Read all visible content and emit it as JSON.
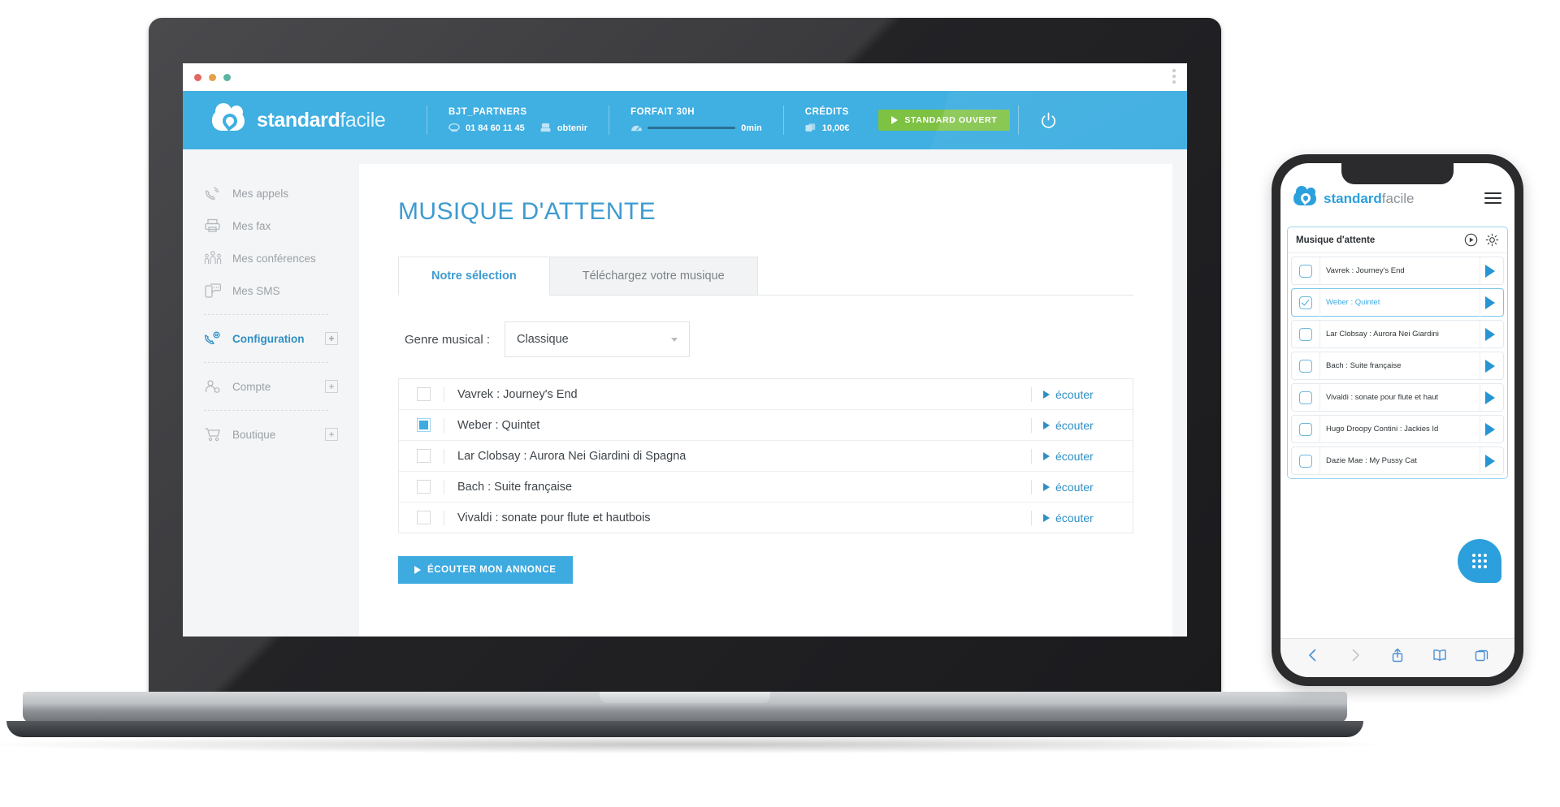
{
  "browser": {
    "kebab_icon": "kebab-menu-icon"
  },
  "header": {
    "brand_bold": "standard",
    "brand_light": "facile",
    "account": {
      "title": "BJT_PARTNERS",
      "phone": "01 84 60 11 45",
      "obtain_label": "obtenir"
    },
    "plan": {
      "title": "FORFAIT 30H",
      "usage": "0min"
    },
    "credits": {
      "title": "CRÉDITS",
      "amount": "10,00€"
    },
    "status_button": "STANDARD OUVERT",
    "accent": "#40afe1",
    "green": "#7dc242"
  },
  "sidebar": {
    "items": [
      {
        "label": "Mes appels",
        "icon": "phone-waves-icon",
        "active": false,
        "expandable": false
      },
      {
        "label": "Mes fax",
        "icon": "printer-icon",
        "active": false,
        "expandable": false
      },
      {
        "label": "Mes conférences",
        "icon": "people-group-icon",
        "active": false,
        "expandable": false
      },
      {
        "label": "Mes SMS",
        "icon": "sms-icon",
        "active": false,
        "expandable": false
      },
      {
        "label": "Configuration",
        "icon": "phone-gear-icon",
        "active": true,
        "expandable": true
      },
      {
        "label": "Compte",
        "icon": "user-gear-icon",
        "active": false,
        "expandable": true
      },
      {
        "label": "Boutique",
        "icon": "shopping-cart-icon",
        "active": false,
        "expandable": true
      }
    ],
    "expand_symbol": "+"
  },
  "main": {
    "page_title": "MUSIQUE D'ATTENTE",
    "tabs": [
      {
        "label": "Notre sélection",
        "active": true
      },
      {
        "label": "Téléchargez votre musique",
        "active": false
      }
    ],
    "filter_label": "Genre musical :",
    "genre_selected": "Classique",
    "tracks": [
      {
        "name": "Vavrek : Journey's End",
        "checked": false,
        "listen": "écouter"
      },
      {
        "name": "Weber : Quintet",
        "checked": true,
        "listen": "écouter"
      },
      {
        "name": "Lar Clobsay : Aurora Nei Giardini di Spagna",
        "checked": false,
        "listen": "écouter"
      },
      {
        "name": "Bach : Suite française",
        "checked": false,
        "listen": "écouter"
      },
      {
        "name": "Vivaldi : sonate pour flute et hautbois",
        "checked": false,
        "listen": "écouter"
      }
    ],
    "cta_label": "ÉCOUTER MON ANNONCE"
  },
  "phone": {
    "brand_bold": "standard",
    "brand_light": "facile",
    "menu_icon": "hamburger-menu-icon",
    "panel_title": "Musique d'attente",
    "panel_icons": [
      "play-circle-icon",
      "gear-icon"
    ],
    "tracks": [
      {
        "name": "Vavrek : Journey's End",
        "checked": false
      },
      {
        "name": "Weber : Quintet",
        "checked": true
      },
      {
        "name": "Lar Clobsay : Aurora Nei Giardini",
        "checked": false
      },
      {
        "name": "Bach : Suite française",
        "checked": false
      },
      {
        "name": "Vivaldi : sonate pour flute et haut",
        "checked": false
      },
      {
        "name": "Hugo Droopy Contini : Jackies Id",
        "checked": false
      },
      {
        "name": "Dazie Mae : My Pussy Cat",
        "checked": false
      }
    ],
    "dialpad_icon": "dialpad-icon",
    "bottom_bar": [
      "back-icon",
      "forward-icon",
      "share-icon",
      "bookmarks-icon",
      "tabs-icon"
    ]
  }
}
